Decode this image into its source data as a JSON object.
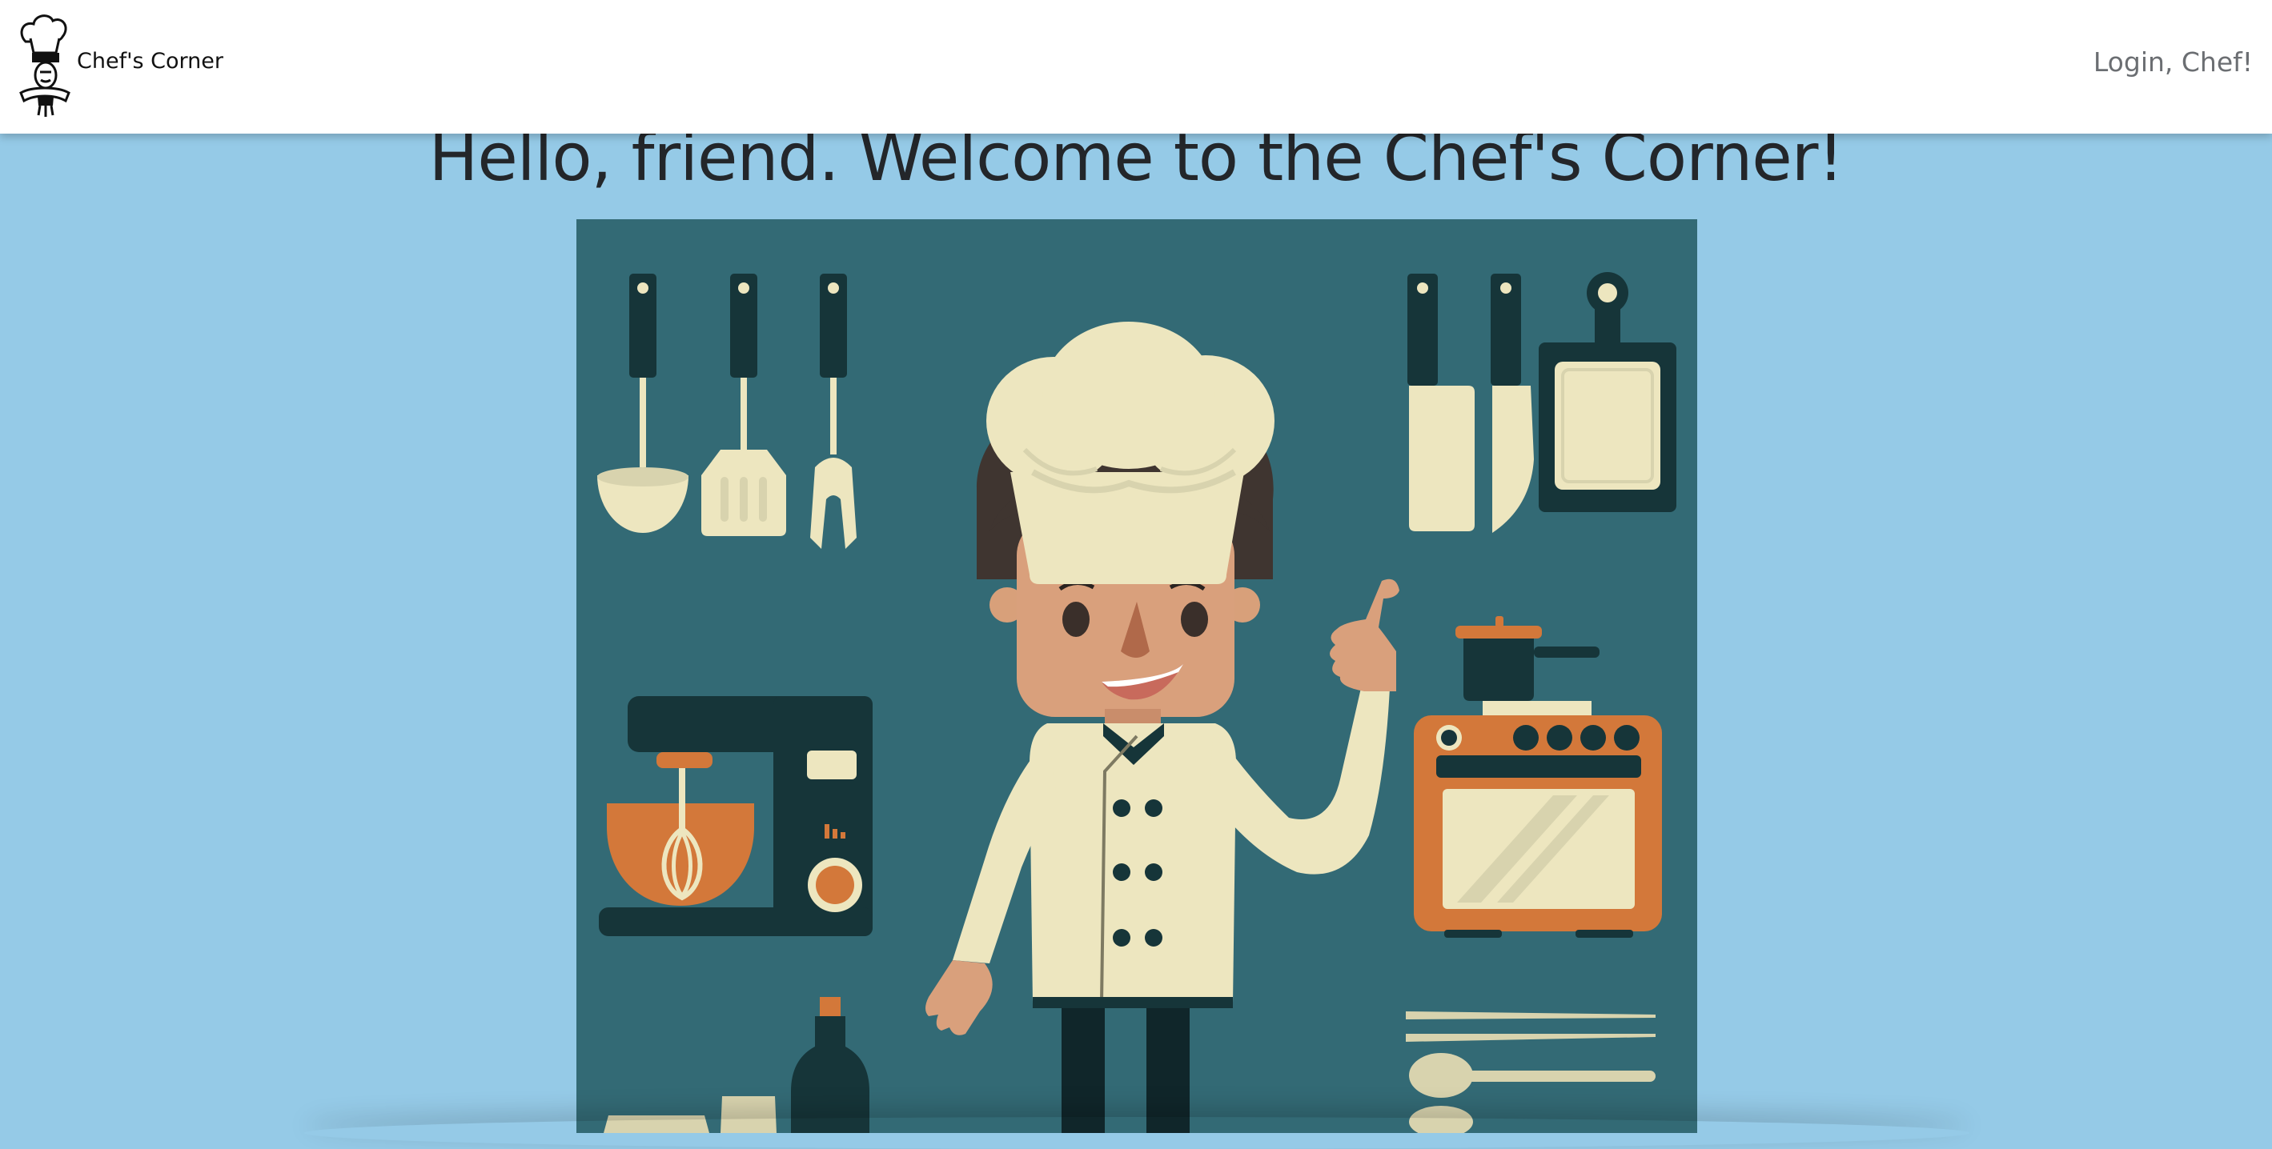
{
  "navbar": {
    "brand_name": "Chef's Corner",
    "logo_icon": "chef-hat-logo-icon",
    "login_label": "Login, Chef!"
  },
  "hero": {
    "heading": "Hello, friend. Welcome to the Chef's Corner!",
    "image_icon": "chef-illustration"
  },
  "colors": {
    "page_background": "#95cae7",
    "navbar_background": "#ffffff",
    "illustration_background": "#336a75",
    "cream": "#ede6bf",
    "dark_teal": "#163539",
    "orange": "#d3783a"
  }
}
